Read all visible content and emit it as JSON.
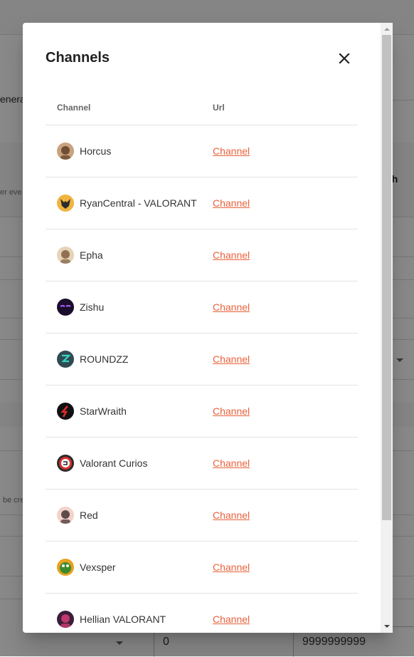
{
  "background": {
    "fragments": {
      "genera": "enera",
      "search_header": "ch",
      "filter_placeholder": "er eve",
      "create_hint": "be cre"
    },
    "filter_inputs": {
      "min_value": "0",
      "max_value": "9999999999"
    }
  },
  "dialog": {
    "title": "Channels",
    "close_icon": "close-icon",
    "table": {
      "headers": {
        "channel": "Channel",
        "url": "Url"
      },
      "rows": [
        {
          "name": "Horcus",
          "link": "Channel",
          "avatar": {
            "bg": "#c9a27e",
            "fg": "#5a3a22",
            "type": "face"
          }
        },
        {
          "name": "RyanCentral - VALORANT",
          "link": "Channel",
          "avatar": {
            "bg": "#f0b440",
            "fg": "#2b2b2b",
            "type": "fox"
          }
        },
        {
          "name": "Epha",
          "link": "Channel",
          "avatar": {
            "bg": "#e6d3b8",
            "fg": "#7b5a3a",
            "type": "face"
          }
        },
        {
          "name": "Zishu",
          "link": "Channel",
          "avatar": {
            "bg": "#1a0d2b",
            "fg": "#b060ff",
            "type": "eyes"
          }
        },
        {
          "name": "ROUNDZZ",
          "link": "Channel",
          "avatar": {
            "bg": "#2f4a52",
            "fg": "#33d6c0",
            "type": "logo"
          }
        },
        {
          "name": "StarWraith",
          "link": "Channel",
          "avatar": {
            "bg": "#111111",
            "fg": "#e02b2b",
            "type": "slash"
          }
        },
        {
          "name": "Valorant Curios",
          "link": "Channel",
          "avatar": {
            "bg": "#2b2b2b",
            "fg": "#ffffff",
            "type": "gc"
          }
        },
        {
          "name": "Red",
          "link": "Channel",
          "avatar": {
            "bg": "#f3d2c9",
            "fg": "#3a2a2a",
            "type": "face"
          }
        },
        {
          "name": "Vexsper",
          "link": "Channel",
          "avatar": {
            "bg": "#e8a21f",
            "fg": "#3c8a2e",
            "type": "frog"
          }
        },
        {
          "name": "Hellian VALORANT",
          "link": "Channel",
          "avatar": {
            "bg": "#3a1d3a",
            "fg": "#e0407a",
            "type": "face"
          }
        }
      ]
    }
  },
  "colors": {
    "accent_link": "#e8623c",
    "overlay": "rgba(0,0,0,0.46)"
  }
}
